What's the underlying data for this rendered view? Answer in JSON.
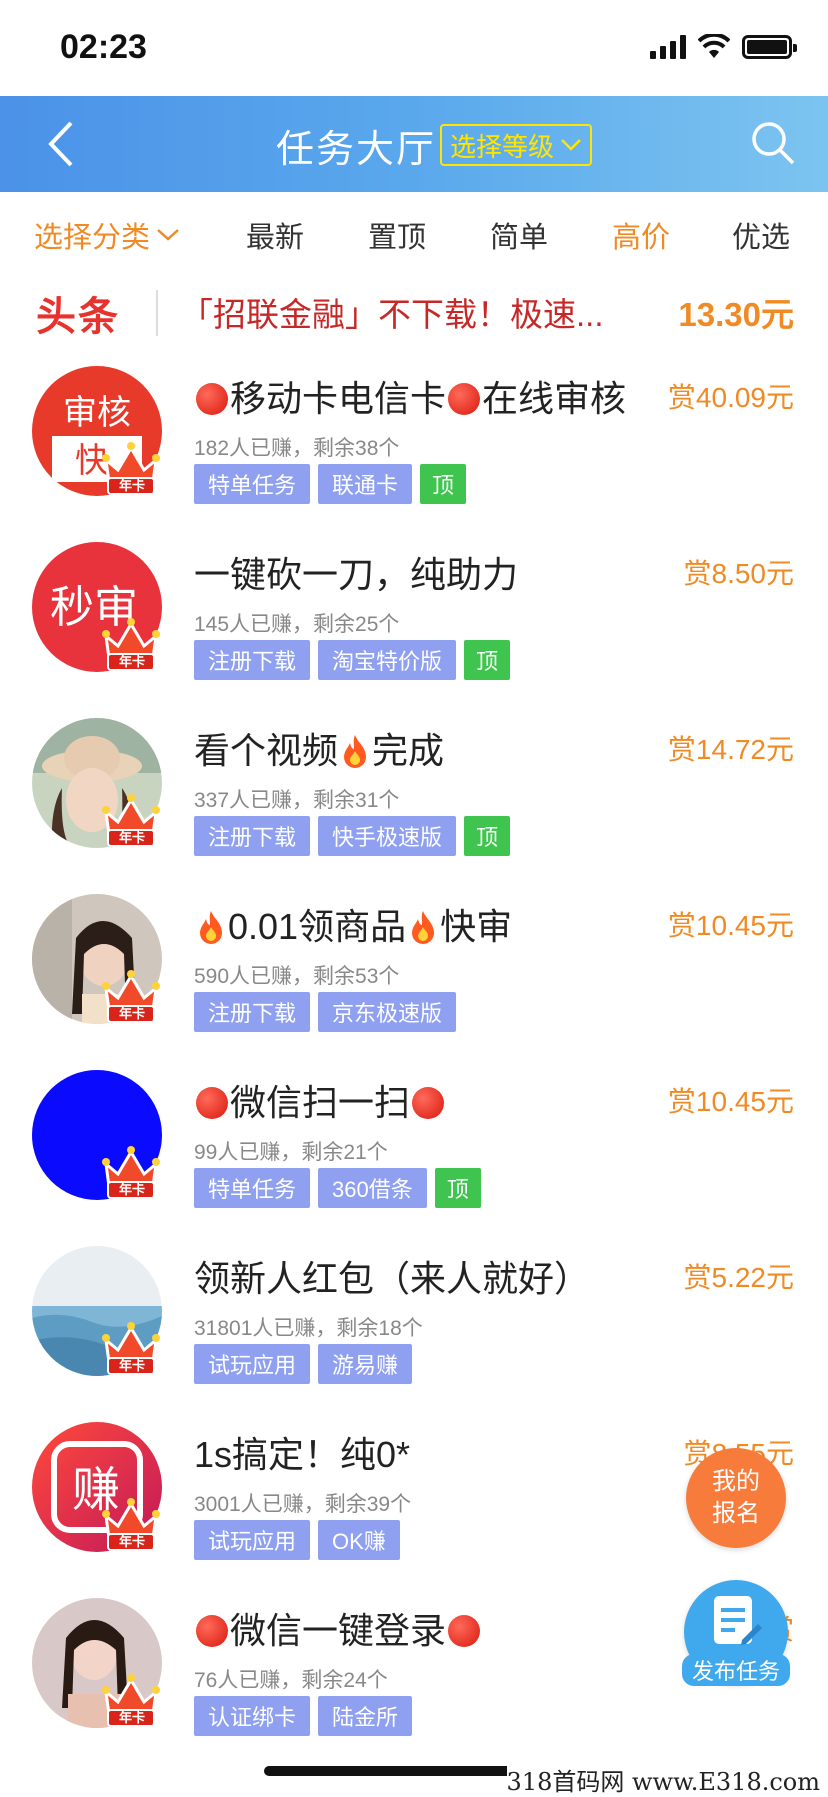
{
  "status_bar": {
    "time": "02:23"
  },
  "nav": {
    "title": "任务大厅",
    "grade_button": "选择等级"
  },
  "tabs": [
    {
      "label": "选择分类",
      "active": true
    },
    {
      "label": "最新"
    },
    {
      "label": "置顶"
    },
    {
      "label": "简单"
    },
    {
      "label": "高价",
      "highlight": true
    },
    {
      "label": "优选"
    }
  ],
  "headline": {
    "tag": "头条",
    "text": "「招联金融」不下载！极速...",
    "price": "13.30元"
  },
  "tasks": [
    {
      "title_parts": [
        "dot",
        "移动卡电信卡",
        "dot",
        "在线审核"
      ],
      "reward": "赏40.09元",
      "meta": "182人已赚，剩余38个",
      "tags": [
        "特单任务",
        "联通卡"
      ],
      "top": true,
      "avatar": "审核快"
    },
    {
      "title_parts": [
        "一键砍一刀，纯助力"
      ],
      "reward": "赏8.50元",
      "meta": "145人已赚，剩余25个",
      "tags": [
        "注册下载",
        "淘宝特价版"
      ],
      "top": true,
      "avatar": "秒审"
    },
    {
      "title_parts": [
        "看个视频",
        "fire",
        "完成"
      ],
      "reward": "赏14.72元",
      "meta": "337人已赚，剩余31个",
      "tags": [
        "注册下载",
        "快手极速版"
      ],
      "top": true,
      "avatar": "photo-woman-hat"
    },
    {
      "title_parts": [
        "fire",
        "0.01领商品",
        "fire",
        "快审"
      ],
      "reward": "赏10.45元",
      "meta": "590人已赚，剩余53个",
      "tags": [
        "注册下载",
        "京东极速版"
      ],
      "top": false,
      "avatar": "photo-woman"
    },
    {
      "title_parts": [
        "dot",
        "微信扫一扫",
        "dot"
      ],
      "reward": "赏10.45元",
      "meta": "99人已赚，剩余21个",
      "tags": [
        "特单任务",
        "360借条"
      ],
      "top": true,
      "avatar": "blue-circle"
    },
    {
      "title_parts": [
        "领新人红包（来人就好）"
      ],
      "reward": "赏5.22元",
      "meta": "31801人已赚，剩余18个",
      "tags": [
        "试玩应用",
        "游易赚"
      ],
      "top": false,
      "avatar": "photo-sea"
    },
    {
      "title_parts": [
        "1s搞定！纯0*"
      ],
      "reward": "赏8.55元",
      "meta": "3001人已赚，剩余39个",
      "tags": [
        "试玩应用",
        "OK赚"
      ],
      "top": false,
      "avatar": "赚"
    },
    {
      "title_parts": [
        "dot",
        "微信一键登录",
        "dot"
      ],
      "reward": "赏",
      "meta": "76人已赚，剩余24个",
      "tags": [
        "认证绑卡",
        "陆金所"
      ],
      "top": false,
      "avatar": "photo-woman-2"
    }
  ],
  "common": {
    "top_label": "顶",
    "crown_label": "年卡"
  },
  "fab": {
    "join_line1": "我的",
    "join_line2": "报名",
    "publish": "发布任务"
  },
  "watermark": "318首码网 www.E318.com"
}
